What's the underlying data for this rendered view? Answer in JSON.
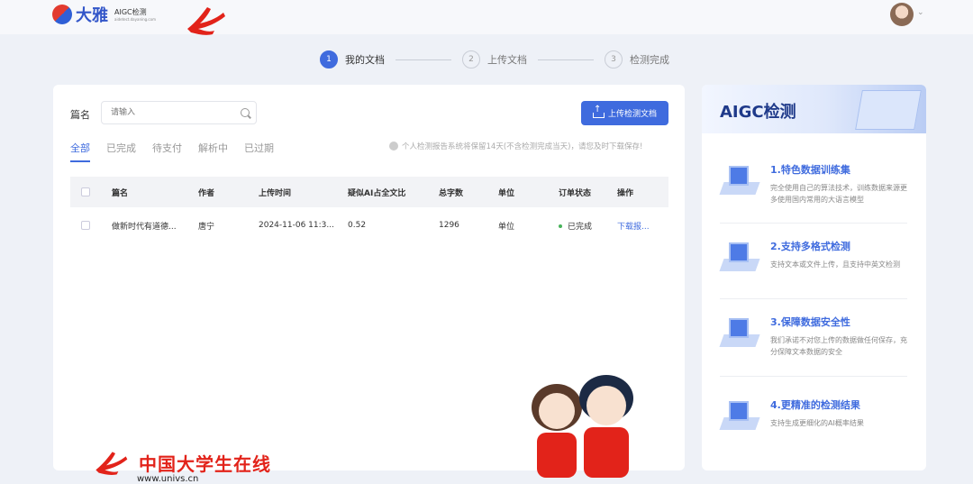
{
  "header": {
    "brand_name": "大雅",
    "brand_sub": "AIGC检测",
    "brand_sub_small": "aidetect.dayaning.com"
  },
  "steps": [
    {
      "num": "1",
      "label": "我的文档"
    },
    {
      "num": "2",
      "label": "上传文档"
    },
    {
      "num": "3",
      "label": "检测完成"
    }
  ],
  "filters": {
    "title_label": "篇名",
    "search_placeholder": "请输入",
    "upload_button": "上传检测文档"
  },
  "tabs": [
    "全部",
    "已完成",
    "待支付",
    "解析中",
    "已过期"
  ],
  "notice": "个人检测报告系统将保留14天(不含检测完成当天)，请您及时下载保存!",
  "table": {
    "headers": [
      "篇名",
      "作者",
      "上传时间",
      "疑似AI占全文比",
      "总字数",
      "单位",
      "订单状态",
      "操作"
    ],
    "rows": [
      {
        "title": "做新时代有道德...",
        "author": "唐宁",
        "upload_time": "2024-11-06 11:3...",
        "ai_ratio": "0.52",
        "word_count": "1296",
        "unit": "单位",
        "status": "已完成",
        "action": "下载报..."
      }
    ]
  },
  "sidebar": {
    "title": "AIGC检测",
    "features": [
      {
        "title": "1.特色数据训练集",
        "desc": "完全使用自己的算法技术，训练数据来源更多使用国内常用的大语言模型"
      },
      {
        "title": "2.支持多格式检测",
        "desc": "支持文本或文件上传，且支持中英文检测"
      },
      {
        "title": "3.保障数据安全性",
        "desc": "我们承诺不对您上传的数据做任何保存，充分保障文本数据的安全"
      },
      {
        "title": "4.更精准的检测结果",
        "desc": "支持生成更细化的AI概率结果"
      }
    ]
  },
  "footer": {
    "name": "中国大学生在线",
    "url": "www.univs.cn"
  },
  "colors": {
    "accent": "#3f6bde",
    "brand_red": "#e2231a",
    "success": "#47b25a"
  }
}
